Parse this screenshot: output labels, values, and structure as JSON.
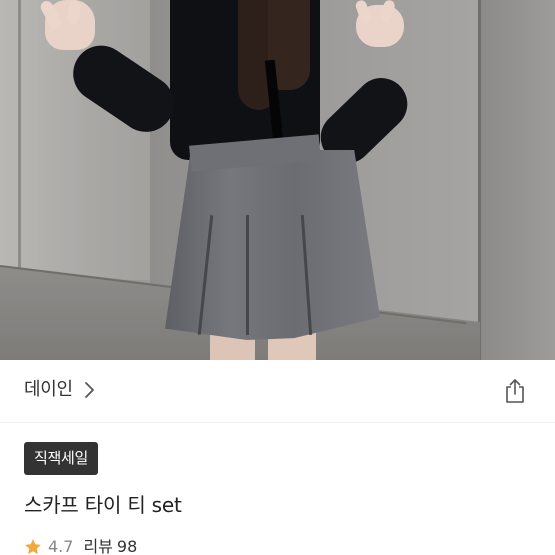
{
  "product": {
    "seller": "데이인",
    "badge": "직잭세일",
    "title": "스카프 타이 티 set",
    "rating": "4.7",
    "review_label": "리뷰",
    "review_count": "98"
  },
  "icons": {
    "chevron": "chevron-right-icon",
    "share": "share-icon",
    "star": "star-icon"
  },
  "colors": {
    "star": "#F2A93B",
    "badge_bg": "#333333",
    "text_primary": "#222222",
    "text_muted": "#888888"
  }
}
